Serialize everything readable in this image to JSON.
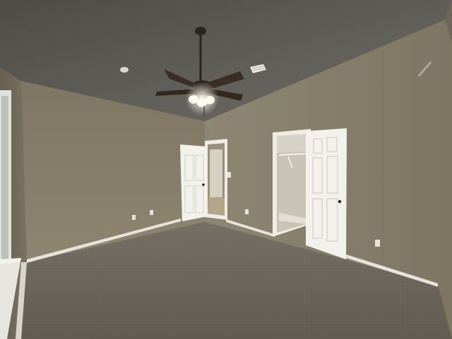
{
  "scene": {
    "subject": "empty-bedroom",
    "palette": {
      "ceiling": "#5e5c55",
      "wall_back": "#857b66",
      "wall_right": "#8c8470",
      "wall_left": "#766d5c",
      "carpet": "#6e675d",
      "trim": "#e9e6df",
      "door": "#f1efea",
      "fan": "#2b2522"
    },
    "objects": [
      "ceiling-fan",
      "hallway-door",
      "closet-door",
      "window",
      "baseboards",
      "outlets",
      "air-vent",
      "smoke-detector",
      "closet-shelf"
    ]
  }
}
